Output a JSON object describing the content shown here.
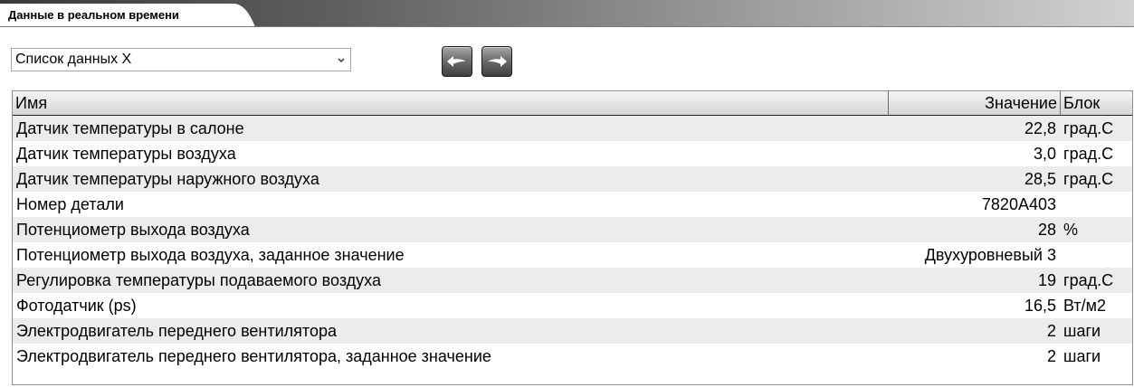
{
  "tab": {
    "title": "Данные в реальном времени"
  },
  "toolbar": {
    "list_select_value": "Список данных X",
    "back_button": "arrow-left-icon",
    "forward_button": "arrow-right-icon"
  },
  "table": {
    "columns": {
      "name": "Имя",
      "value": "Значение",
      "unit": "Блок"
    },
    "rows": [
      {
        "name": "Датчик температуры в салоне",
        "value": "22,8",
        "unit": "град.С"
      },
      {
        "name": "Датчик температуры воздуха",
        "value": "3,0",
        "unit": "град.С"
      },
      {
        "name": "Датчик температуры наружного воздуха",
        "value": "28,5",
        "unit": "град.С"
      },
      {
        "name": "Номер детали",
        "value": "7820A403",
        "unit": ""
      },
      {
        "name": "Потенциометр выхода воздуха",
        "value": "28",
        "unit": "%"
      },
      {
        "name": "Потенциометр выхода воздуха, заданное значение",
        "value": "Двухуровневый 3",
        "unit": ""
      },
      {
        "name": "Регулировка температуры подаваемого воздуха",
        "value": "19",
        "unit": "град.С"
      },
      {
        "name": "Фотодатчик (ps)",
        "value": "16,5",
        "unit": "Вт/м2"
      },
      {
        "name": "Электродвигатель переднего вентилятора",
        "value": "2",
        "unit": "шаги"
      },
      {
        "name": "Электродвигатель переднего вентилятора, заданное значение",
        "value": "2",
        "unit": "шаги"
      }
    ]
  }
}
